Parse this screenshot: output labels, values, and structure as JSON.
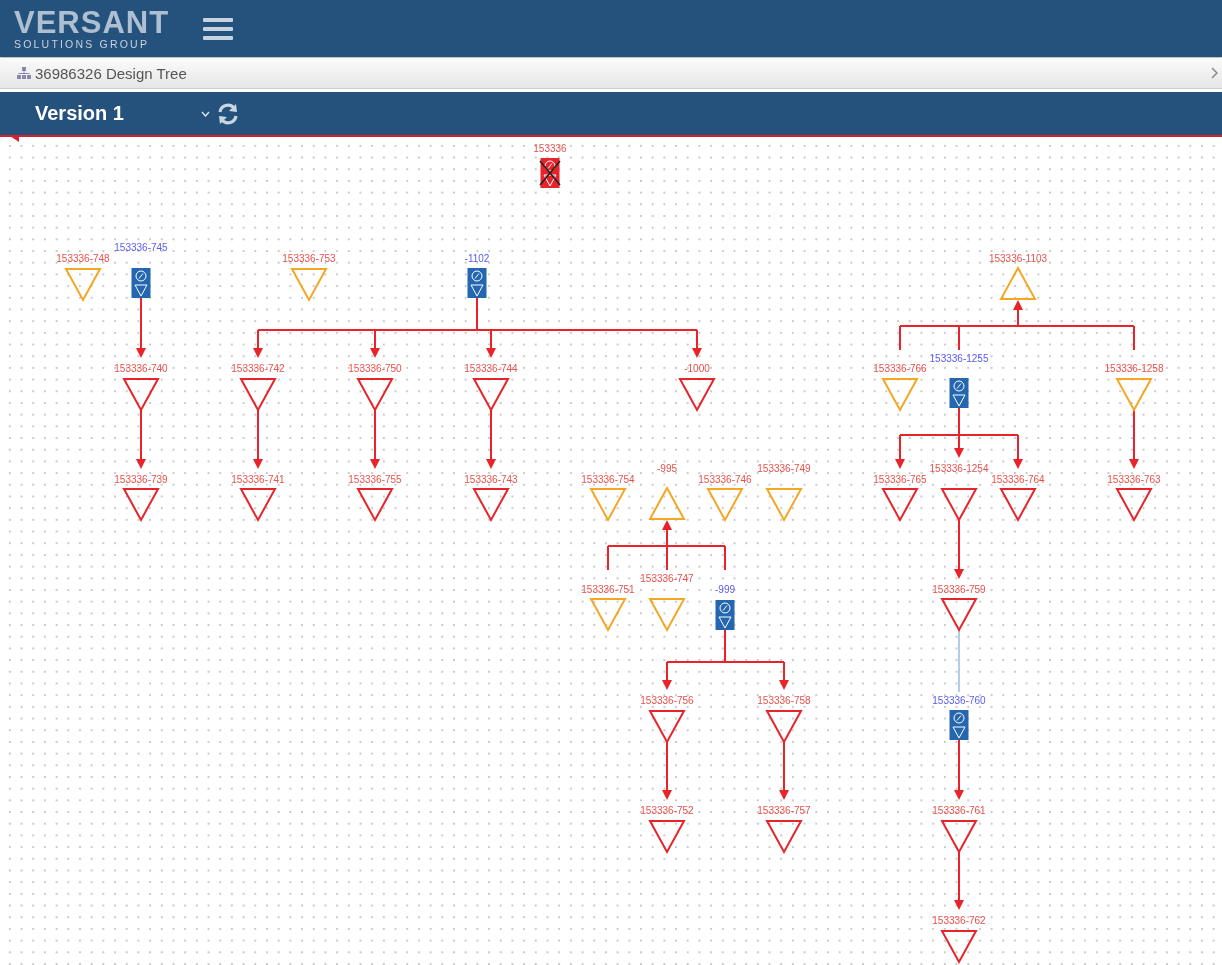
{
  "header": {
    "logo_name": "VERSANT",
    "logo_tagline": "SOLUTIONS GROUP"
  },
  "breadcrumb": {
    "title": "36986326 Design Tree"
  },
  "version_bar": {
    "version": "Version 1"
  },
  "nodes": [
    {
      "kind": "assembly",
      "label": "153336",
      "crossed": true
    },
    {
      "kind": "down",
      "label": "153336-748",
      "color": "#f5a623"
    },
    {
      "kind": "assembly",
      "label": "153336-745",
      "crossed": false,
      "children": [
        {
          "kind": "down",
          "label": "153336-740",
          "color": "#e8232a",
          "children": [
            {
              "kind": "down",
              "label": "153336-739",
              "color": "#e8232a"
            }
          ]
        }
      ]
    },
    {
      "kind": "down",
      "label": "153336-753",
      "color": "#f5a623"
    },
    {
      "kind": "assembly",
      "label": "-1102",
      "crossed": false,
      "children": [
        {
          "kind": "down",
          "label": "153336-742",
          "color": "#e8232a",
          "children": [
            {
              "kind": "down",
              "label": "153336-741",
              "color": "#e8232a"
            }
          ]
        },
        {
          "kind": "down",
          "label": "153336-750",
          "color": "#e8232a",
          "children": [
            {
              "kind": "down",
              "label": "153336-755",
              "color": "#e8232a"
            }
          ]
        },
        {
          "kind": "down",
          "label": "153336-744",
          "color": "#e8232a",
          "children": [
            {
              "kind": "down",
              "label": "153336-743",
              "color": "#e8232a"
            }
          ]
        },
        {
          "kind": "down",
          "label": "-1000",
          "color": "#e8232a"
        }
      ]
    },
    {
      "kind": "down",
      "label": "153336-754",
      "color": "#f5a623"
    },
    {
      "kind": "up",
      "label": "-995",
      "color": "#f5a623",
      "children": [
        {
          "kind": "down",
          "label": "153336-751",
          "color": "#f5a623"
        },
        {
          "kind": "down",
          "label": "153336-747",
          "color": "#f5a623"
        },
        {
          "kind": "assembly",
          "label": "-999",
          "crossed": false,
          "children": [
            {
              "kind": "down",
              "label": "153336-756",
              "color": "#e8232a",
              "children": [
                {
                  "kind": "down",
                  "label": "153336-752",
                  "color": "#e8232a"
                }
              ]
            },
            {
              "kind": "down",
              "label": "153336-758",
              "color": "#e8232a",
              "children": [
                {
                  "kind": "down",
                  "label": "153336-757",
                  "color": "#e8232a"
                }
              ]
            }
          ]
        }
      ]
    },
    {
      "kind": "down",
      "label": "153336-746",
      "color": "#f5a623"
    },
    {
      "kind": "down",
      "label": "153336-749",
      "color": "#f5a623"
    },
    {
      "kind": "up",
      "label": "153336-1103",
      "color": "#f5a623",
      "children": [
        {
          "kind": "down",
          "label": "153336-766",
          "color": "#f5a623"
        },
        {
          "kind": "assembly",
          "label": "153336-1255",
          "crossed": false,
          "children": [
            {
              "kind": "down",
              "label": "153336-765",
              "color": "#e8232a"
            },
            {
              "kind": "down",
              "label": "153336-1254",
              "color": "#e8232a",
              "children": [
                {
                  "kind": "down",
                  "label": "153336-759",
                  "color": "#e8232a",
                  "children": [
                    {
                      "kind": "assembly",
                      "label": "153336-760",
                      "crossed": false,
                      "plain_link": true,
                      "children": [
                        {
                          "kind": "down",
                          "label": "153336-761",
                          "color": "#e8232a",
                          "children": [
                            {
                              "kind": "down",
                              "label": "153336-762",
                              "color": "#e8232a"
                            }
                          ]
                        }
                      ]
                    }
                  ]
                }
              ]
            },
            {
              "kind": "down",
              "label": "153336-764",
              "color": "#e8232a"
            }
          ]
        },
        {
          "kind": "down",
          "label": "153336-1258",
          "color": "#f5a623",
          "children": [
            {
              "kind": "down",
              "label": "153336-763",
              "color": "#e8232a"
            }
          ]
        }
      ]
    }
  ]
}
